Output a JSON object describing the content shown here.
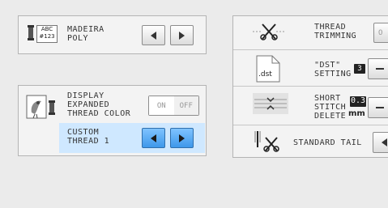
{
  "thread_brand": {
    "icon_label_top": "ABC",
    "icon_label_bottom": "#123",
    "line1": "MADEIRA",
    "line2": "POLY"
  },
  "display_expanded": {
    "line1": "DISPLAY",
    "line2": "EXPANDED",
    "line3": "THREAD COLOR",
    "on_label": "ON",
    "off_label": "OFF",
    "state": "OFF"
  },
  "custom_thread": {
    "line1": "CUSTOM",
    "line2": "THREAD 1"
  },
  "thread_trimming": {
    "line1": "THREAD",
    "line2": "TRIMMING",
    "toggle_partial": "O"
  },
  "dst_setting": {
    "icon_label": ".dst",
    "line1": "\"DST\"",
    "line2": "SETTING",
    "value": "3"
  },
  "short_stitch": {
    "line1": "SHORT",
    "line2": "STITCH",
    "line3": "DELETE",
    "value": "0.3",
    "unit": "mm"
  },
  "tail": {
    "label": "STANDARD TAIL"
  }
}
